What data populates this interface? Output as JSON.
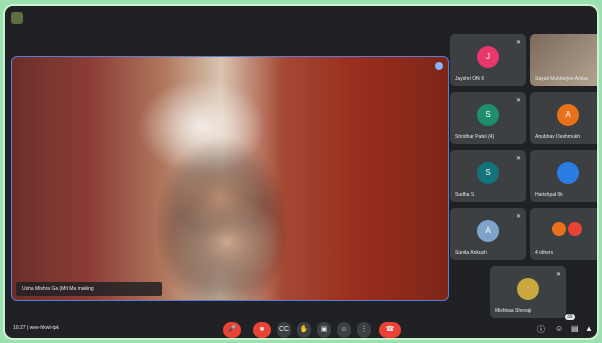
{
  "main_video": {
    "name_label": "Usha Mishra Ga (Mtl Ma making"
  },
  "tiles": [
    {
      "name": "Jayshri Ofk 6",
      "initial": "J",
      "color": "#e8386b"
    },
    {
      "name": "Sayati Mukherjee Amba",
      "initial": "",
      "color": "#7a6a5a"
    },
    {
      "name": "Shridhar Patel (4)",
      "initial": "S",
      "color": "#1e8e6e"
    },
    {
      "name": "Anubhav Deshmukh",
      "initial": "A",
      "color": "#e8711a"
    },
    {
      "name": "Sudha S",
      "initial": "S",
      "color": "#12737a"
    },
    {
      "name": "Harishpal 0k",
      "initial": "",
      "color": "#2a7de1"
    },
    {
      "name": "Sunita Ankush",
      "initial": "A",
      "color": "#7fa3c9"
    },
    {
      "name": "4 others",
      "initial": "",
      "color": "#e8711a"
    },
    {
      "name": "Mishkaa Shevaji",
      "initial": "",
      "color": "#c9a840"
    }
  ],
  "bottom_bar": {
    "time": "10:27  |  wee-hkwt-tpk",
    "badge": "39",
    "controls": [
      "mic",
      "camera",
      "captions",
      "raise",
      "present",
      "emoji",
      "more",
      "end"
    ]
  },
  "icons": {
    "mic_off": "mic-off-icon",
    "pin": "pin-icon",
    "info": "info-icon",
    "people": "people-icon",
    "chat": "chat-icon",
    "activities": "activities-icon"
  }
}
